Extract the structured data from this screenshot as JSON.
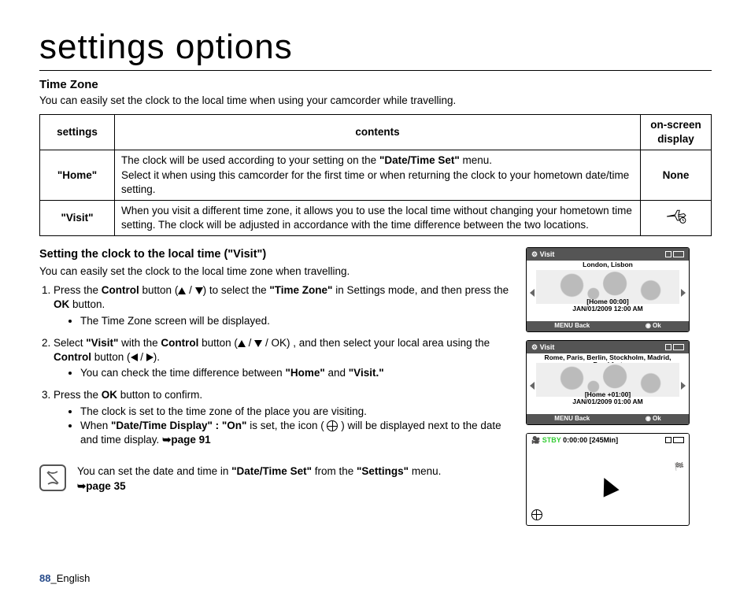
{
  "page_title": "settings options",
  "section": {
    "heading": "Time Zone",
    "intro": "You can easily set the clock to the local time when using your camcorder while travelling."
  },
  "table": {
    "headers": {
      "c1": "settings",
      "c2": "contents",
      "c3": "on-screen display"
    },
    "rows": [
      {
        "setting": "\"Home\"",
        "contents_pre": "The clock will be used according to your setting on the ",
        "contents_bold": "\"Date/Time Set\"",
        "contents_post": " menu.\nSelect it when using this camcorder for the first time or when returning the clock to your hometown date/time setting.",
        "display": "None"
      },
      {
        "setting": "\"Visit\"",
        "contents": "When you visit a different time zone, it allows you to use the local time without changing your hometown time setting. The clock will be adjusted in accordance with the time difference between the two locations.",
        "display_icon": "plane-clock-icon"
      }
    ]
  },
  "subsection": {
    "heading": "Setting the clock to the local time (\"Visit\")",
    "intro": "You can easily set the clock to the local time zone when travelling."
  },
  "steps": [
    {
      "num": "1.",
      "t1": "Press the ",
      "b1": "Control",
      "t2": " button (",
      "t3": " / ",
      "t4": ") to select the ",
      "b2": "\"Time Zone\"",
      "t5": " in Settings mode, and then press the ",
      "b3": "OK",
      "t6": " button.",
      "bullets": [
        "The Time Zone screen will be displayed."
      ]
    },
    {
      "num": "2.",
      "t1": "Select ",
      "b1": "\"Visit\"",
      "t2": " with the ",
      "b2": "Control",
      "t3": " button (",
      "t4": " / ",
      "t5": " / OK) , and then select your local area using the ",
      "b3": "Control",
      "t6": " button (",
      "t7": " / ",
      "t8": ").",
      "bullets_pre": "You can check the time difference between ",
      "bullets_b1": "\"Home\"",
      "bullets_mid": " and ",
      "bullets_b2": "\"Visit.\""
    },
    {
      "num": "3.",
      "t1": "Press the ",
      "b1": "OK",
      "t2": " button to confirm.",
      "bullets": [
        "The clock is set to the time zone of the place you are visiting."
      ],
      "bullet2_pre": "When ",
      "bullet2_b1": "\"Date/Time Display\" : \"On\"",
      "bullet2_mid": " is set, the icon ( ",
      "bullet2_post": " ) will be displayed next to the date and time display. ",
      "bullet2_ref": "➥page 91"
    }
  ],
  "note": {
    "t1": "You can set the date and time in ",
    "b1": "\"Date/Time Set\"",
    "t2": " from the ",
    "b2": "\"Settings\"",
    "t3": " menu.",
    "ref": "➥page 35"
  },
  "footer": {
    "page": "88",
    "lang": "_English"
  },
  "thumbs": {
    "visit1": {
      "title": "Visit",
      "city": "London, Lisbon",
      "home": "[Home 00:00]",
      "dt": "JAN/01/2009 12:00 AM",
      "back": "Back",
      "ok": "Ok",
      "menu": "MENU"
    },
    "visit2": {
      "title": "Visit",
      "city": "Rome, Paris, Berlin, Stockholm, Madrid, Frankfurt",
      "home": "[Home +01:00]",
      "dt": "JAN/01/2009 01:00 AM",
      "back": "Back",
      "ok": "Ok",
      "menu": "MENU"
    },
    "stby": {
      "label": "STBY",
      "time": "0:00:00",
      "remain": "[245Min]"
    }
  }
}
